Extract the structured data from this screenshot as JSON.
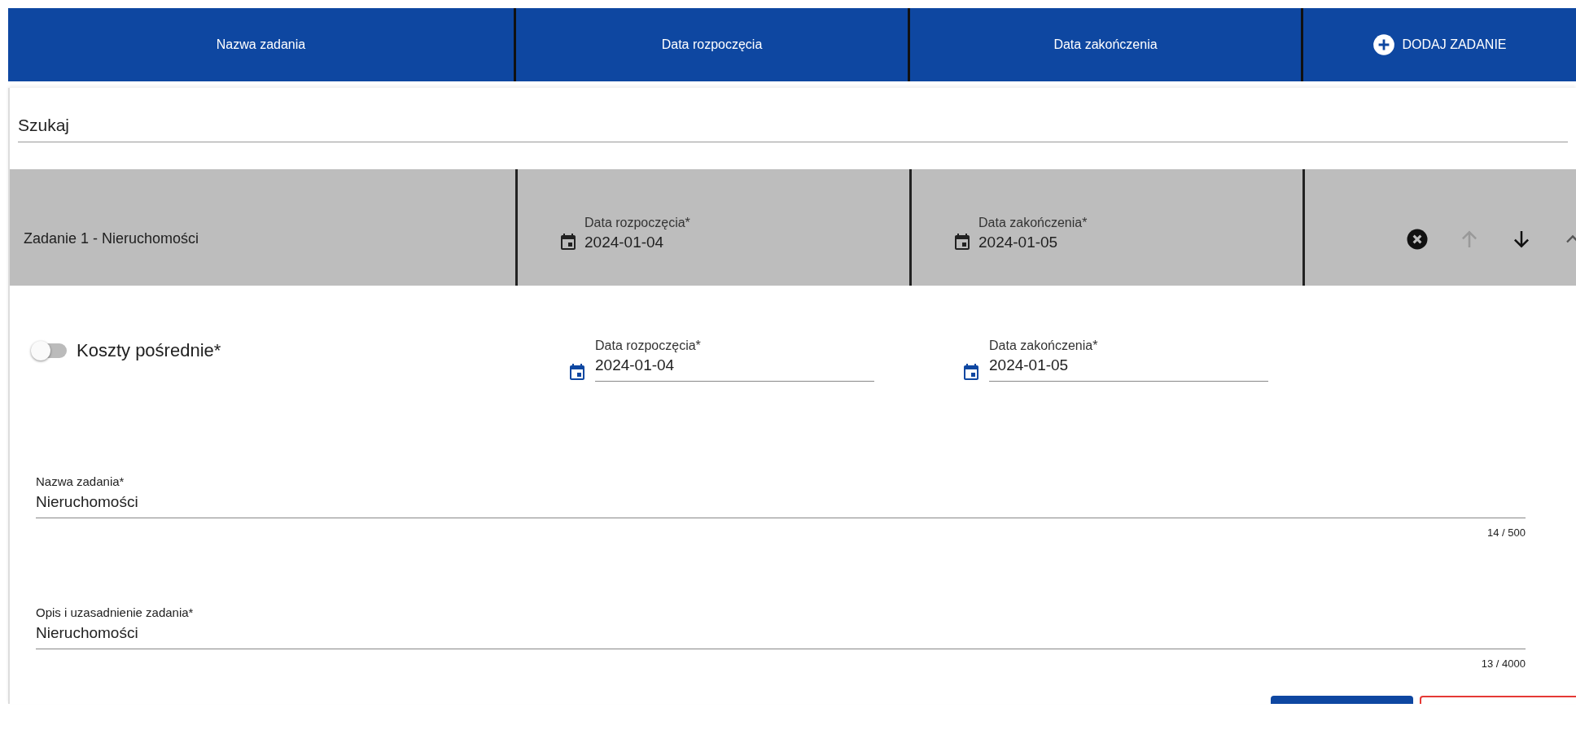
{
  "columns": [
    {
      "label": "Nazwa zadania"
    },
    {
      "label": "Data rozpoczęcia"
    },
    {
      "label": "Data zakończenia"
    }
  ],
  "add_button": {
    "label": "DODAJ ZADANIE"
  },
  "search": {
    "placeholder": "Szukaj"
  },
  "tasks": [
    {
      "title": "Zadanie 1 - Nieruchomości",
      "expanded": true,
      "start": {
        "label": "Data rozpoczęcia*",
        "value": "2024-01-04"
      },
      "end": {
        "label": "Data zakończenia*",
        "value": "2024-01-05"
      },
      "actions": [
        {
          "kind": "remove",
          "disabled": false
        },
        {
          "kind": "up",
          "disabled": true
        },
        {
          "kind": "down",
          "disabled": false
        }
      ],
      "detail": {
        "indirect_costs": {
          "label": "Koszty pośrednie*",
          "on": false
        },
        "start": {
          "label": "Data rozpoczęcia*",
          "value": "2024-01-04"
        },
        "end": {
          "label": "Data zakończenia*",
          "value": "2024-01-05"
        },
        "fields": [
          {
            "label": "Nazwa zadania*",
            "value": "Nieruchomości",
            "counter": "14 / 500"
          },
          {
            "label": "Opis i uzasadnienie zadania*",
            "value": "Nieruchomości",
            "counter": "13 / 4000"
          }
        ]
      }
    }
  ],
  "footer_buttons": [
    {
      "kind": "primary"
    },
    {
      "kind": "danger"
    }
  ]
}
